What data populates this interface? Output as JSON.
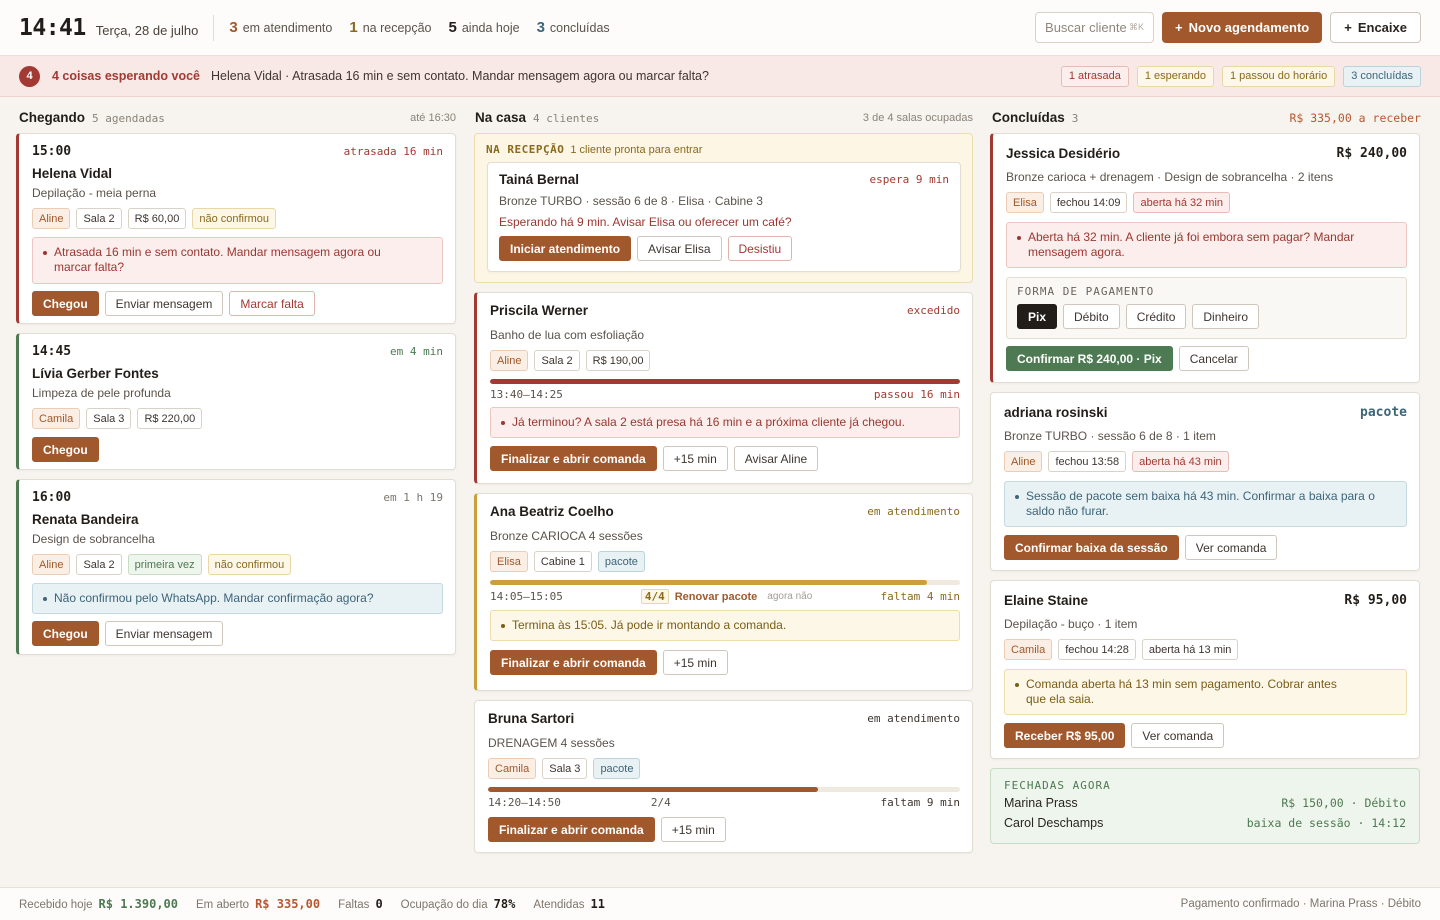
{
  "topbar": {
    "time": "14:41",
    "date": "Terça, 28 de julho",
    "stats": [
      {
        "n": "3",
        "label": "em atendimento",
        "color": "#a0582c"
      },
      {
        "n": "1",
        "label": "na recepção",
        "color": "#8a6a1d"
      },
      {
        "n": "5",
        "label": "ainda hoje",
        "color": "#221d19"
      },
      {
        "n": "3",
        "label": "concluídas",
        "color": "#3d6578"
      }
    ],
    "search_placeholder": "Buscar cliente",
    "search_shortcut": "⌘K",
    "new_label": "Novo agendamento",
    "fit_label": "Encaixe"
  },
  "alert": {
    "count": "4",
    "title": "4 coisas esperando você",
    "text": "Helena Vidal · Atrasada 16 min e sem contato. Mandar mensagem agora ou marcar falta?",
    "pills": [
      "1 atrasada",
      "1 esperando",
      "1 passou do horário",
      "3 concluídas"
    ]
  },
  "chegando": {
    "title": "Chegando",
    "count": "5 agendadas",
    "right": "até 16:30",
    "cards": [
      {
        "time": "15:00",
        "state": "atrasada 16 min",
        "name": "Helena Vidal",
        "service": "Depilação - meia perna",
        "tags": [
          "Aline",
          "Sala 2",
          "R$ 60,00",
          "não confirmou"
        ],
        "note": "Atrasada 16 min e sem contato. Mandar mensagem agora ou marcar falta?",
        "buttons": [
          "Chegou",
          "Enviar mensagem",
          "Marcar falta"
        ]
      },
      {
        "time": "14:45",
        "state": "em 4 min",
        "name": "Lívia Gerber Fontes",
        "service": "Limpeza de pele profunda",
        "tags": [
          "Camila",
          "Sala 3",
          "R$ 220,00"
        ],
        "buttons": [
          "Chegou"
        ]
      },
      {
        "time": "16:00",
        "state": "em 1 h 19",
        "name": "Renata Bandeira",
        "service": "Design de sobrancelha",
        "tags": [
          "Aline",
          "Sala 2",
          "primeira vez",
          "não confirmou"
        ],
        "note": "Não confirmou pelo WhatsApp. Mandar confirmação agora?",
        "buttons": [
          "Chegou",
          "Enviar mensagem"
        ]
      }
    ]
  },
  "nacasa": {
    "title": "Na casa",
    "count": "4 clientes",
    "right": "3 de 4 salas ocupadas",
    "reception": {
      "label": "NA RECEPÇÃO",
      "sub": "1 cliente pronta para entrar",
      "name": "Tainá Bernal",
      "state": "espera 9 min",
      "service": "Bronze TURBO · sessão 6 de 8 · Elisa · Cabine 3",
      "warn": "Esperando há 9 min. Avisar Elisa ou oferecer um café?",
      "buttons": [
        "Iniciar atendimento",
        "Avisar Elisa",
        "Desistiu"
      ]
    },
    "cards": [
      {
        "name": "Priscila Werner",
        "state": "excedido",
        "service": "Banho de lua com esfoliação",
        "tags": [
          "Aline",
          "Sala 2",
          "R$ 190,00"
        ],
        "progress": 1.0,
        "range": "13:40–14:25",
        "right": "passou 16 min",
        "note": "Já terminou? A sala 2 está presa há 16 min e a próxima cliente já chegou.",
        "buttons": [
          "Finalizar e abrir comanda",
          "+15 min",
          "Avisar Aline"
        ]
      },
      {
        "name": "Ana Beatriz Coelho",
        "state": "em atendimento",
        "service": "Bronze CARIOCA 4 sessões",
        "tags": [
          "Elisa",
          "Cabine 1",
          "pacote"
        ],
        "progress": 0.93,
        "range": "14:05–15:05",
        "session": "4/4",
        "renew": "Renovar pacote",
        "later": "agora não",
        "right": "faltam 4 min",
        "note": "Termina às 15:05. Já pode ir montando a comanda.",
        "buttons": [
          "Finalizar e abrir comanda",
          "+15 min"
        ]
      },
      {
        "name": "Bruna Sartori",
        "state": "em atendimento",
        "service": "DRENAGEM 4 sessões",
        "tags": [
          "Camila",
          "Sala 3",
          "pacote"
        ],
        "progress": 0.7,
        "range": "14:20–14:50",
        "session": "2/4",
        "right": "faltam 9 min",
        "buttons": [
          "Finalizar e abrir comanda",
          "+15 min"
        ]
      }
    ]
  },
  "concluidas": {
    "title": "Concluídas",
    "count": "3",
    "right": "R$ 335,00 a receber",
    "cards": [
      {
        "name": "Jessica Desidério",
        "price": "R$ 240,00",
        "service": "Bronze carioca + drenagem · Design de sobrancelha · 2 itens",
        "tags": [
          "Elisa",
          "fechou 14:09",
          "aberta há 32 min"
        ],
        "note": "Aberta há 32 min. A cliente já foi embora sem pagar? Mandar mensagem agora.",
        "pay_label": "FORMA DE PAGAMENTO",
        "pay_options": [
          "Pix",
          "Débito",
          "Crédito",
          "Dinheiro"
        ],
        "buttons": [
          "Confirmar R$ 240,00 · Pix",
          "Cancelar"
        ]
      },
      {
        "name": "adriana rosinski",
        "price": "pacote",
        "service": "Bronze TURBO · sessão 6 de 8 · 1 item",
        "tags": [
          "Aline",
          "fechou 13:58",
          "aberta há 43 min"
        ],
        "note": "Sessão de pacote sem baixa há 43 min. Confirmar a baixa para o saldo não furar.",
        "buttons": [
          "Confirmar baixa da sessão",
          "Ver comanda"
        ]
      },
      {
        "name": "Elaine Staine",
        "price": "R$ 95,00",
        "service": "Depilação - buço · 1 item",
        "tags": [
          "Camila",
          "fechou 14:28",
          "aberta há 13 min"
        ],
        "note": "Comanda aberta há 13 min sem pagamento. Cobrar antes que ela saia.",
        "buttons": [
          "Receber R$ 95,00",
          "Ver comanda"
        ]
      }
    ],
    "closed": {
      "label": "FECHADAS AGORA",
      "rows": [
        {
          "name": "Marina Prass",
          "value": "R$ 150,00 · Débito"
        },
        {
          "name": "Carol Deschamps",
          "value": "baixa de sessão · 14:12"
        }
      ]
    }
  },
  "footer": {
    "received_label": "Recebido hoje",
    "received": "R$ 1.390,00",
    "open_label": "Em aberto",
    "open": "R$ 335,00",
    "missed_label": "Faltas",
    "missed": "0",
    "occupancy_label": "Ocupação do dia",
    "occupancy": "78%",
    "served_label": "Atendidas",
    "served": "11",
    "toast": "Pagamento confirmado · Marina Prass · Débito"
  }
}
